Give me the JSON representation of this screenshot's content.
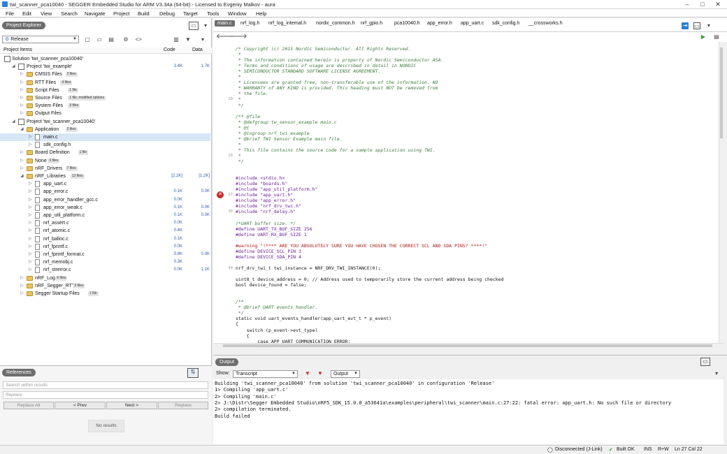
{
  "window": {
    "title": "twi_scanner_pca10040 - SEGGER Embedded Studio for ARM V3.34a (64-bit) - Licensed to Evgeniy Malkov - aura"
  },
  "menu": [
    "File",
    "Edit",
    "View",
    "Search",
    "Navigate",
    "Project",
    "Build",
    "Debug",
    "Target",
    "Tools",
    "Window",
    "Help"
  ],
  "project_explorer": {
    "title": "Project Explorer",
    "config": "Release",
    "columns": {
      "name": "Project Items",
      "code": "Code",
      "data": "Data"
    },
    "rows": [
      {
        "label": "Solution 'twi_scanner_pca10040'",
        "code": "",
        "data": "",
        "badge": ""
      },
      {
        "label": "Project 'twi_example'",
        "code": "3.4K",
        "data": "1.7K",
        "badge": ""
      },
      {
        "label": "CMSIS Files",
        "code": "",
        "data": "",
        "badge": "2 files"
      },
      {
        "label": "RTT Files",
        "code": "",
        "data": "",
        "badge": "4 files"
      },
      {
        "label": "Script Files",
        "code": "",
        "data": "",
        "badge": "1 file"
      },
      {
        "label": "Source Files",
        "code": "",
        "data": "",
        "badge": "1 file, modified options"
      },
      {
        "label": "System Files",
        "code": "",
        "data": "",
        "badge": "3 files"
      },
      {
        "label": "Output Files",
        "code": "",
        "data": "",
        "badge": ""
      },
      {
        "label": "Project 'twi_scanner_pca10040'",
        "code": "",
        "data": "",
        "badge": ""
      },
      {
        "label": "Application",
        "code": "",
        "data": "",
        "badge": "2 files"
      },
      {
        "label": "main.c",
        "code": "",
        "data": "",
        "badge": ""
      },
      {
        "label": "sdk_config.h",
        "code": "",
        "data": "",
        "badge": ""
      },
      {
        "label": "Board Definition",
        "code": "",
        "data": "",
        "badge": "1 file"
      },
      {
        "label": "None",
        "code": "",
        "data": "",
        "badge": "3 files"
      },
      {
        "label": "nRF_Drivers",
        "code": "",
        "data": "",
        "badge": "7 files"
      },
      {
        "label": "nRF_Libraries",
        "code": "[2.2K]",
        "data": "[1.2K]",
        "badge": "12 files"
      },
      {
        "label": "app_uart.c",
        "code": "",
        "data": "",
        "badge": ""
      },
      {
        "label": "app_error.c",
        "code": "0.1K",
        "data": "0.0K",
        "badge": ""
      },
      {
        "label": "app_error_handler_gcc.c",
        "code": "0.0K",
        "data": "",
        "badge": ""
      },
      {
        "label": "app_error_weak.c",
        "code": "0.1K",
        "data": "0.0K",
        "badge": ""
      },
      {
        "label": "app_util_platform.c",
        "code": "0.1K",
        "data": "0.0K",
        "badge": ""
      },
      {
        "label": "nrf_assert.c",
        "code": "0.0K",
        "data": "",
        "badge": ""
      },
      {
        "label": "nrf_atomic.c",
        "code": "0.4K",
        "data": "",
        "badge": ""
      },
      {
        "label": "nrf_balloc.c",
        "code": "0.1K",
        "data": "",
        "badge": ""
      },
      {
        "label": "nrf_fprintf.c",
        "code": "0.0K",
        "data": "",
        "badge": ""
      },
      {
        "label": "nrf_fprintf_format.c",
        "code": "0.8K",
        "data": "0.0K",
        "badge": ""
      },
      {
        "label": "nrf_memobj.c",
        "code": "0.3K",
        "data": "",
        "badge": ""
      },
      {
        "label": "nrf_strerror.c",
        "code": "0.0K",
        "data": "1.1K",
        "badge": ""
      },
      {
        "label": "nRF_Log",
        "code": "",
        "data": "",
        "badge": "6 files"
      },
      {
        "label": "nRF_Segger_RTT",
        "code": "",
        "data": "",
        "badge": "3 files"
      },
      {
        "label": "Segger Startup Files",
        "code": "",
        "data": "",
        "badge": "1 file"
      }
    ]
  },
  "references": {
    "title": "References",
    "search_placeholder": "Search within results",
    "replace_placeholder": "Replace",
    "btn_replace_all": "Replace All",
    "btn_prev": "< Prev",
    "btn_next": "Next >",
    "btn_replace": "Replace",
    "no_results": "No results"
  },
  "tabs": [
    "main.c",
    "nrf_log.h",
    "nrf_log_internal.h",
    "nordic_common.h",
    "nrf_gpio.h",
    "pca10040.h",
    "app_error.h",
    "app_uart.c",
    "sdk_config.h",
    "__crossworks.h"
  ],
  "editor_lines": [
    {
      "n": "",
      "t": "/* Copyright (c) 2015 Nordic Semiconductor. All Rights Reserved.",
      "c": "cm"
    },
    {
      "n": "",
      "t": " *",
      "c": "cm"
    },
    {
      "n": "",
      "t": " * The information contained herein is property of Nordic Semiconductor ASA.",
      "c": "cm"
    },
    {
      "n": "",
      "t": " * Terms and conditions of usage are described in detail in NORDIC",
      "c": "cm"
    },
    {
      "n": "",
      "t": " * SEMICONDUCTOR STANDARD SOFTWARE LICENSE AGREEMENT.",
      "c": "cm"
    },
    {
      "n": "",
      "t": " *",
      "c": "cm"
    },
    {
      "n": "",
      "t": " * Licensees are granted free, non-transferable use of the information. NO",
      "c": "cm"
    },
    {
      "n": "",
      "t": " * WARRANTY of ANY KIND is provided. This heading must NOT be removed from",
      "c": "cm"
    },
    {
      "n": "",
      "t": " * the file.",
      "c": "cm"
    },
    {
      "n": "10",
      "t": " *",
      "c": "cm"
    },
    {
      "n": "",
      "t": " */",
      "c": "cm"
    },
    {
      "n": "",
      "t": "",
      "c": ""
    },
    {
      "n": "",
      "t": "/** @file",
      "c": "cm"
    },
    {
      "n": "",
      "t": " * @defgroup tw_sensor_example main.c",
      "c": "cm"
    },
    {
      "n": "",
      "t": " * @{",
      "c": "cm"
    },
    {
      "n": "",
      "t": " * @ingroup nrf_twi_example",
      "c": "cm"
    },
    {
      "n": "",
      "t": " * @brief TWI Sensor Example main file.",
      "c": "cm"
    },
    {
      "n": "",
      "t": " *",
      "c": "cm"
    },
    {
      "n": "",
      "t": " * This file contains the source code for a sample application using TWI.",
      "c": "cm"
    },
    {
      "n": "20",
      "t": " *",
      "c": "cm"
    },
    {
      "n": "",
      "t": " */",
      "c": "cm"
    },
    {
      "n": "",
      "t": "",
      "c": ""
    },
    {
      "n": "",
      "t": "",
      "c": ""
    },
    {
      "n": "",
      "t": "#include <stdio.h>",
      "c": "pp"
    },
    {
      "n": "",
      "t": "#include \"boards.h\"",
      "c": "pp"
    },
    {
      "n": "",
      "t": "#include \"app_util_platform.h\"",
      "c": "pp"
    },
    {
      "n": "27",
      "t": "#include \"app_uart.h\"",
      "c": "pp"
    },
    {
      "n": "",
      "t": "#include \"app_error.h\"",
      "c": "pp"
    },
    {
      "n": "",
      "t": "#include \"nrf_drv_twi.h\"",
      "c": "pp"
    },
    {
      "n": "30",
      "t": "#include \"nrf_delay.h\"",
      "c": "pp"
    },
    {
      "n": "",
      "t": "",
      "c": ""
    },
    {
      "n": "",
      "t": "/*UART buffer size. */",
      "c": "cm"
    },
    {
      "n": "",
      "t": "#define UART_TX_BUF_SIZE 256",
      "c": "pp"
    },
    {
      "n": "",
      "t": "#define UART_RX_BUF_SIZE 1",
      "c": "pp"
    },
    {
      "n": "",
      "t": "",
      "c": ""
    },
    {
      "n": "",
      "t": "#warning \"!**** ARE YOU ABSOLUTELY SURE YOU HAVE CHOSEN THE CORRECT SCL AND SDA PINS? ****!\"",
      "c": "st"
    },
    {
      "n": "",
      "t": "#define DEVICE_SCL_PIN 3",
      "c": "pp"
    },
    {
      "n": "",
      "t": "#define DEVICE_SDA_PIN 4",
      "c": "pp"
    },
    {
      "n": "",
      "t": "",
      "c": ""
    },
    {
      "n": "40",
      "t": "nrf_drv_twi_t twi_instance = NRF_DRV_TWI_INSTANCE(0);",
      "c": ""
    },
    {
      "n": "",
      "t": "",
      "c": ""
    },
    {
      "n": "",
      "t": "uint8_t device_address = 0; // Address used to temporarily store the current address being checked",
      "c": ""
    },
    {
      "n": "",
      "t": "bool device_found = false;",
      "c": ""
    },
    {
      "n": "",
      "t": "",
      "c": ""
    },
    {
      "n": "",
      "t": "",
      "c": ""
    },
    {
      "n": "",
      "t": "/**",
      "c": "cm"
    },
    {
      "n": "",
      "t": " * @brief UART events handler.",
      "c": "cm"
    },
    {
      "n": "",
      "t": " */",
      "c": "cm"
    },
    {
      "n": "",
      "t": "static void uart_events_handler(app_uart_evt_t * p_event)",
      "c": ""
    },
    {
      "n": "",
      "t": "{",
      "c": ""
    },
    {
      "n": "",
      "t": "    switch (p_event->evt_type)",
      "c": ""
    },
    {
      "n": "",
      "t": "    {",
      "c": ""
    },
    {
      "n": "",
      "t": "        case APP_UART_COMMUNICATION_ERROR:",
      "c": ""
    }
  ],
  "output": {
    "title": "Output",
    "show_label": "Show:",
    "show_value": "Transcript",
    "output_value": "Output",
    "lines": [
      "Building 'twi_scanner_pca10040' from solution 'twi_scanner_pca10040' in configuration 'Release'",
      "1> Compiling 'app_uart.c'",
      "2> Compiling 'main.c'",
      "2> J:\\Distr\\Segger Embedded Studio\\nRF5_SDK_15.0.0_a53641a\\examples\\peripheral\\twi_scanner\\main.c:27:22: fatal error: app_uart.h: No such file or directory",
      "2> compilation terminated.",
      "Build failed"
    ]
  },
  "status": {
    "connection": "Disconnected (J-Link)",
    "build": "Built OK",
    "ins": "INS",
    "rw": "R+W",
    "pos": "Ln 27 Col 22"
  },
  "colors": {
    "accent": "#2a7fd4",
    "error": "#c62828",
    "tab_active": "#6d6d6d"
  }
}
